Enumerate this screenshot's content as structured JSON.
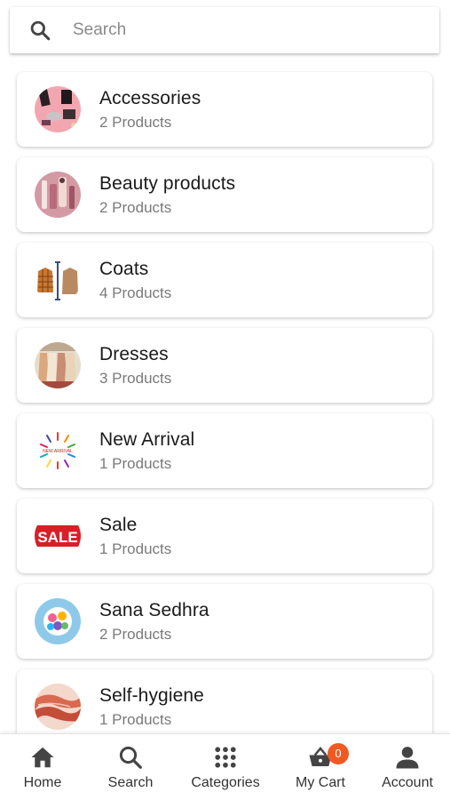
{
  "search": {
    "placeholder": "Search",
    "icon": "search-icon"
  },
  "categories": [
    {
      "name": "Accessories",
      "count": "2 Products"
    },
    {
      "name": "Beauty products",
      "count": "2 Products"
    },
    {
      "name": "Coats",
      "count": "4 Products"
    },
    {
      "name": "Dresses",
      "count": "3 Products"
    },
    {
      "name": "New Arrival",
      "count": "1 Products"
    },
    {
      "name": "Sale",
      "count": "1 Products"
    },
    {
      "name": "Sana Sedhra",
      "count": "2 Products"
    },
    {
      "name": "Self-hygiene",
      "count": "1 Products"
    }
  ],
  "thumb_texts": {
    "new_arrival": "NEW ARRIVAL",
    "sale": "SALE"
  },
  "nav": {
    "home": "Home",
    "search": "Search",
    "categories": "Categories",
    "cart": "My Cart",
    "cart_count": "0",
    "account": "Account"
  },
  "colors": {
    "badge": "#f05a22",
    "icon": "#444444"
  }
}
